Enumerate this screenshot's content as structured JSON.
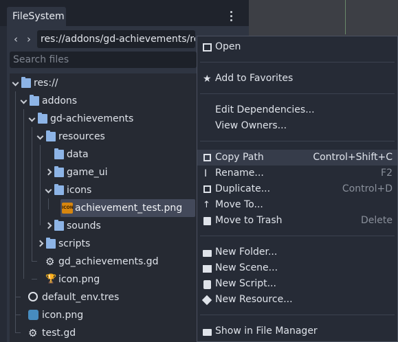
{
  "dock": {
    "tab_title": "FileSystem",
    "path": "res://addons/gd-achievements/resources/icons/achievement_test.png",
    "search_placeholder": "Search files"
  },
  "tree": [
    {
      "label": "res://",
      "type": "folder",
      "expanded": true
    },
    {
      "label": "addons",
      "type": "folder",
      "expanded": true
    },
    {
      "label": "gd-achievements",
      "type": "folder",
      "expanded": true
    },
    {
      "label": "resources",
      "type": "folder",
      "expanded": true
    },
    {
      "label": "data",
      "type": "folder",
      "expanded": false
    },
    {
      "label": "game_ui",
      "type": "folder",
      "expanded": false
    },
    {
      "label": "icons",
      "type": "folder",
      "expanded": true
    },
    {
      "label": "achievement_test.png",
      "type": "image",
      "selected": true,
      "icon_text": "ICON"
    },
    {
      "label": "sounds",
      "type": "folder",
      "expanded": false
    },
    {
      "label": "scripts",
      "type": "folder",
      "expanded": false
    },
    {
      "label": "gd_achievements.gd",
      "type": "gear"
    },
    {
      "label": "icon.png",
      "type": "trophy"
    },
    {
      "label": "default_env.tres",
      "type": "globe"
    },
    {
      "label": "icon.png",
      "type": "godot"
    },
    {
      "label": "test.gd",
      "type": "gear"
    }
  ],
  "context_menu": {
    "open": "Open",
    "add_to_favorites": "Add to Favorites",
    "edit_dependencies": "Edit Dependencies...",
    "view_owners": "View Owners...",
    "copy_path": "Copy Path",
    "copy_path_shortcut": "Control+Shift+C",
    "rename": "Rename...",
    "rename_shortcut": "F2",
    "duplicate": "Duplicate...",
    "duplicate_shortcut": "Control+D",
    "move_to": "Move To...",
    "move_to_trash": "Move to Trash",
    "move_to_trash_shortcut": "Delete",
    "new_folder": "New Folder...",
    "new_scene": "New Scene...",
    "new_script": "New Script...",
    "new_resource": "New Resource...",
    "show_in_file_manager": "Show in File Manager"
  },
  "colors": {
    "folder": "#8db4e6",
    "highlight": "#363c4a",
    "selected_row": "#43495a"
  }
}
